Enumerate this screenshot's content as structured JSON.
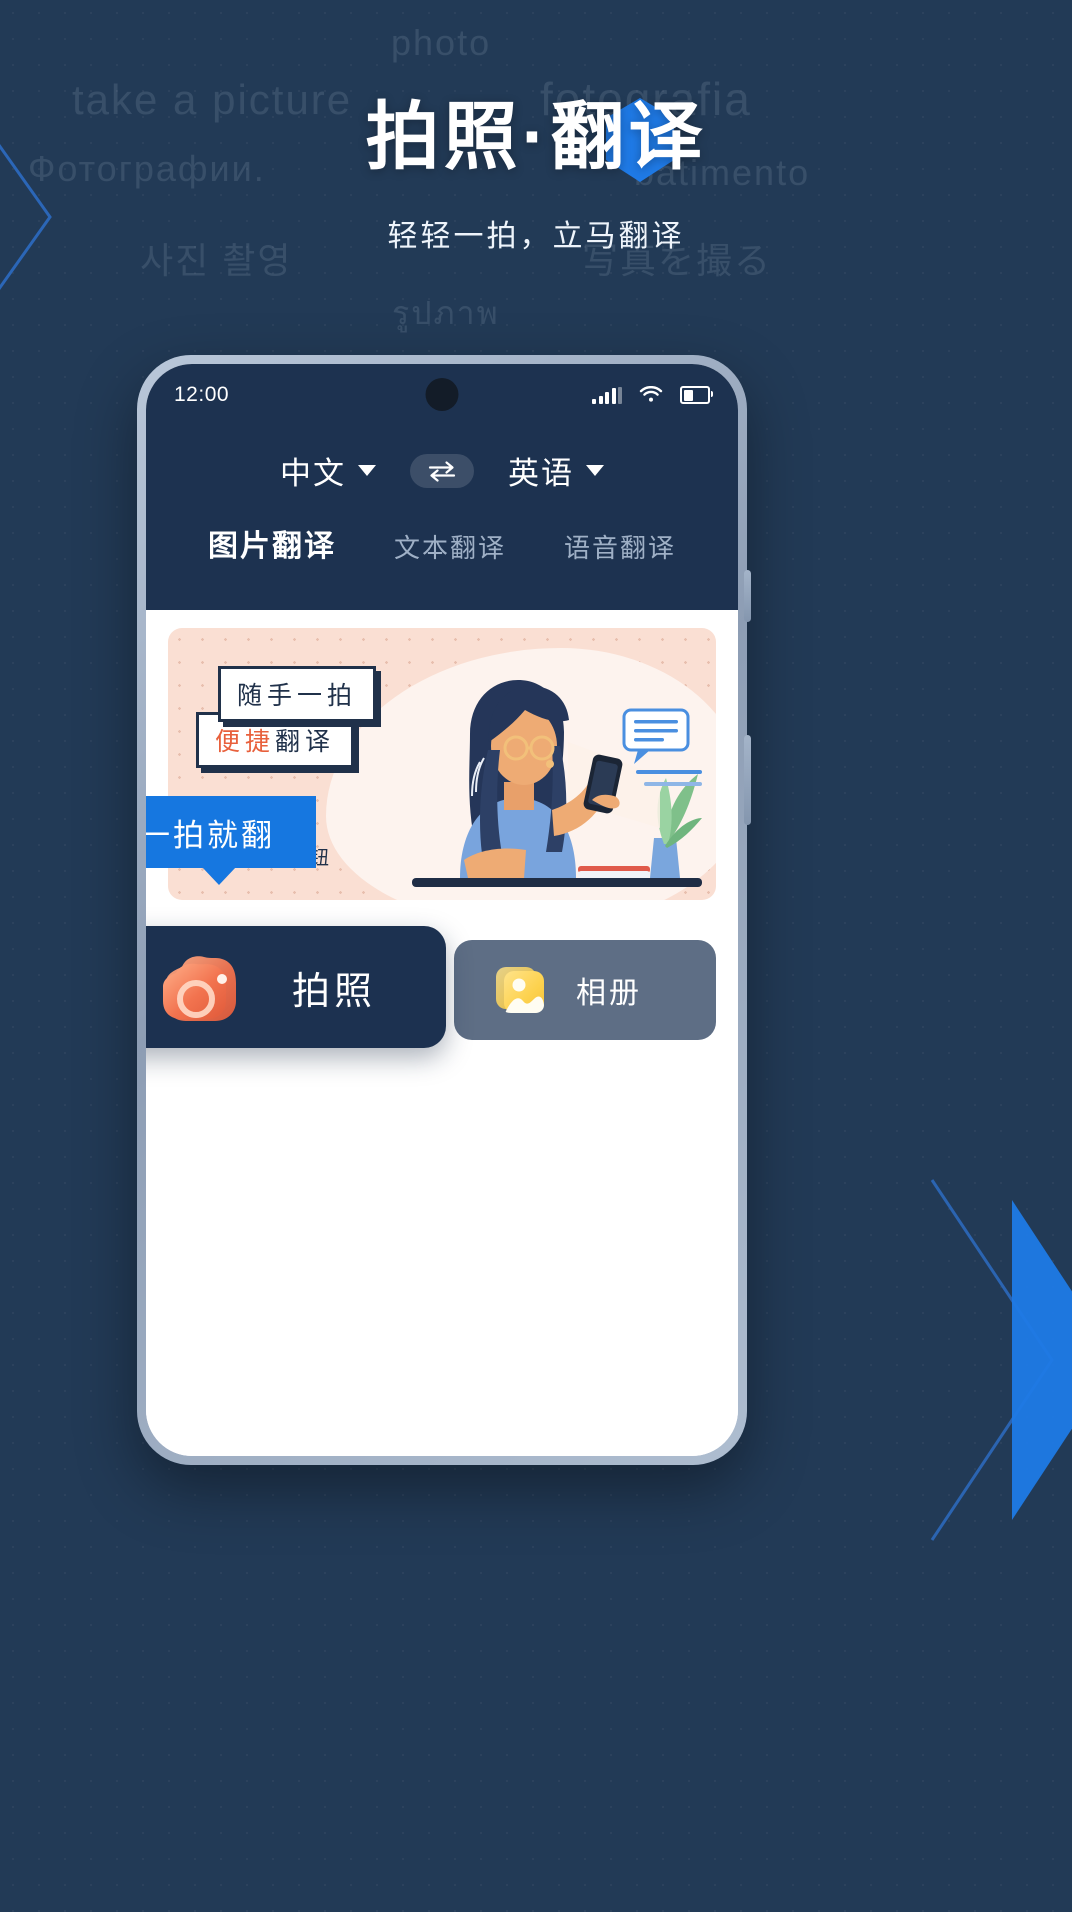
{
  "hero": {
    "title": "拍照·翻译",
    "subtitle": "轻轻一拍，立马翻译"
  },
  "background_words": [
    {
      "text": "photo"
    },
    {
      "text": "take a picture"
    },
    {
      "text": "fotografia"
    },
    {
      "text": "Фотографии."
    },
    {
      "text": "batimento"
    },
    {
      "text": "사진 촬영"
    },
    {
      "text": "写真を撮る"
    },
    {
      "text": "รูปภาพ"
    }
  ],
  "phone": {
    "status_bar": {
      "time": "12:00",
      "signal_icon": "signal-bars-icon",
      "wifi_icon": "wifi-icon",
      "battery_icon": "battery-icon"
    },
    "language_bar": {
      "source": "中文",
      "target": "英语",
      "swap_icon": "swap-arrows-icon",
      "caret_icon": "chevron-down-icon"
    },
    "tabs": [
      {
        "label": "图片翻译",
        "active": true
      },
      {
        "label": "文本翻译",
        "active": false
      },
      {
        "label": "语音翻译",
        "active": false
      }
    ],
    "banner": {
      "tag_top": "随手一拍",
      "tag_bottom_highlight": "便捷",
      "tag_bottom_rest": "翻译",
      "covered_note": "安钮"
    },
    "tooltip": {
      "text": "一拍就翻"
    },
    "actions": [
      {
        "label": "拍照",
        "icon": "camera-icon"
      },
      {
        "label": "相册",
        "icon": "photo-album-icon"
      }
    ]
  },
  "colors": {
    "brand_blue": "#1677e0",
    "page_bg": "#22395a",
    "phone_topbar": "#1d3250",
    "banner_bg": "#fadfd3",
    "accent_orange": "#e8603c",
    "camera_btn": "#1c3150",
    "album_btn": "#5e6e85"
  }
}
